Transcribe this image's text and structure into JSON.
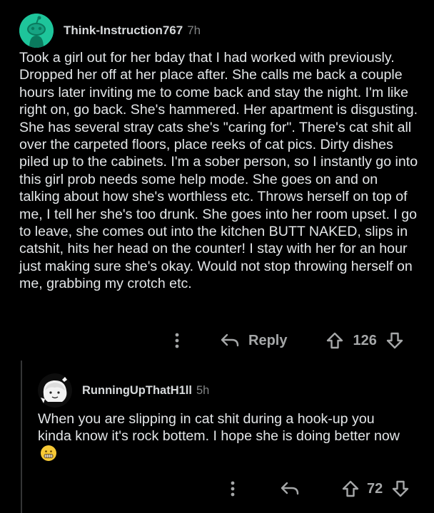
{
  "comment": {
    "username": "Think-Instruction767",
    "age": "7h",
    "body": "Took a girl out for her bday that I had worked with previously. Dropped her off at her place after. She calls me back a couple hours later inviting me to come back and stay the night. I'm like right on, go back. She's hammered. Her apartment is disgusting. She has several stray cats she's \"caring for\". There's cat shit all over the carpeted floors, place reeks of cat pics. Dirty dishes piled up to the cabinets. I'm a sober person, so I instantly go into this girl prob needs some help mode. She goes on and on talking about how she's worthless etc. Throws herself on top of me, I tell her she's too drunk. She goes into her room upset. I go to leave, she comes out into the kitchen BUTT NAKED, slips in catshit, hits her head on the counter! I stay with her for an hour just making sure she's okay. Would not stop throwing herself on me, grabbing my crotch etc.",
    "reply_label": "Reply",
    "votes": "126",
    "more_icon": "more-vertical-icon",
    "reply_icon": "reply-arrow-icon",
    "upvote_icon": "upvote-arrow-icon",
    "downvote_icon": "downvote-arrow-icon",
    "accent": "#1ec59b"
  },
  "reply": {
    "username": "RunningUpThatH1ll",
    "age": "5h",
    "body": "When you are slipping in cat shit during a hook-up you kinda know it's rock bottem. I hope she is doing better now",
    "emoji": "grimacing-face-emoji",
    "votes": "72",
    "more_icon": "more-vertical-icon",
    "reply_icon": "reply-arrow-icon",
    "upvote_icon": "upvote-arrow-icon",
    "downvote_icon": "downvote-arrow-icon"
  }
}
